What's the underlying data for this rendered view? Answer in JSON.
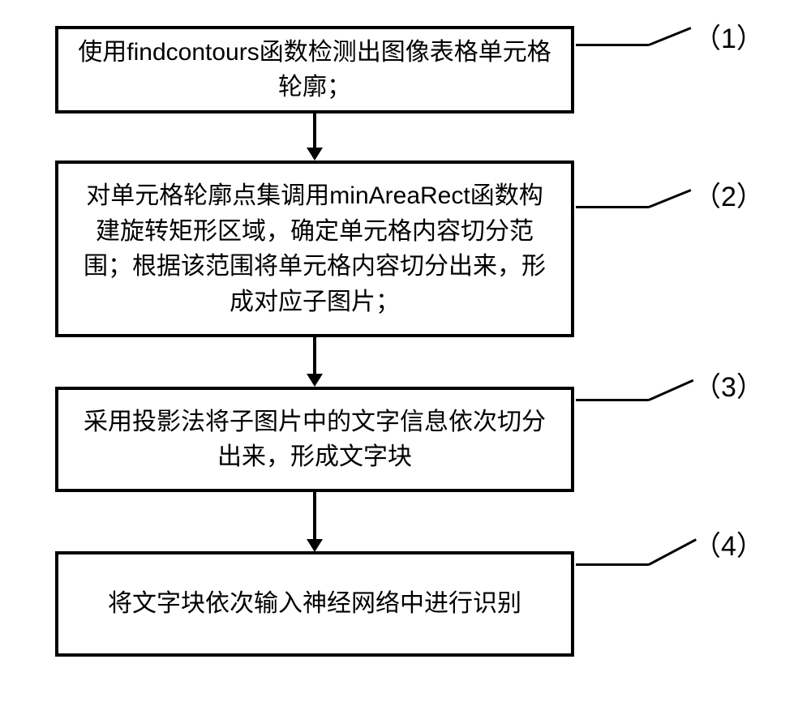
{
  "flow": {
    "steps": [
      {
        "label": "（1）",
        "text": "使用findcontours函数检测出图像表格单元格轮廓；"
      },
      {
        "label": "（2）",
        "text": "对单元格轮廓点集调用minAreaRect函数构建旋转矩形区域，确定单元格内容切分范围；根据该范围将单元格内容切分出来，形成对应子图片；"
      },
      {
        "label": "（3）",
        "text": "采用投影法将子图片中的文字信息依次切分出来，形成文字块"
      },
      {
        "label": "（4）",
        "text": "将文字块依次输入神经网络中进行识别"
      }
    ]
  }
}
